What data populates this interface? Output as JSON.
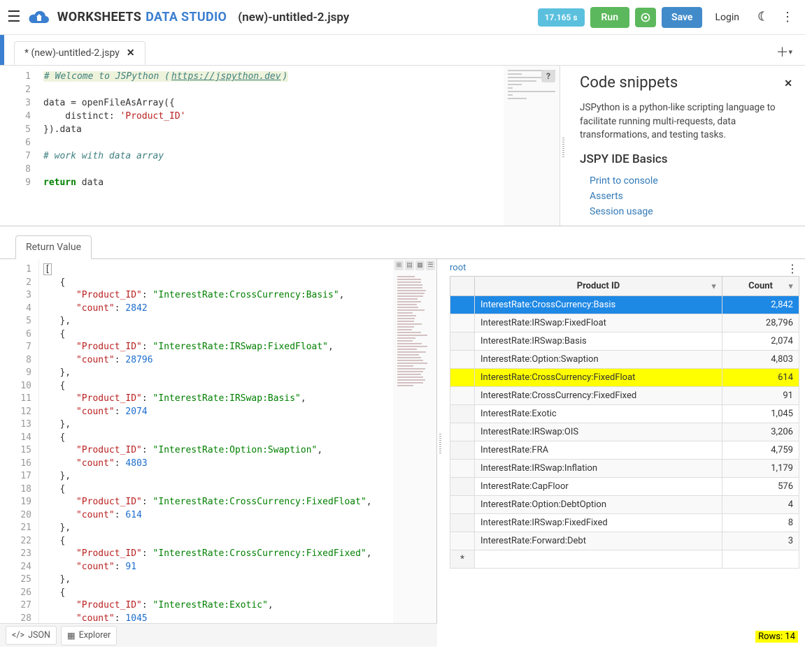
{
  "header": {
    "title_left": "WORKSHEETS",
    "title_right": "DATA STUDIO",
    "filename": "(new)-untitled-2.jspy",
    "time_badge": "17.165 s",
    "run": "Run",
    "save": "Save",
    "login": "Login"
  },
  "tabs": {
    "active": "* (new)-untitled-2.jspy"
  },
  "snippets": {
    "title": "Code snippets",
    "intro": "JSPython is a python-like scripting language to facilitate running multi-requests, data transformations, and testing tasks.",
    "basics_heading": "JSPY IDE Basics",
    "link_print": "Print to console",
    "link_asserts": "Asserts",
    "link_session": "Session usage"
  },
  "editor": {
    "lines": [
      {
        "n": "1",
        "toks": [
          {
            "cls": "cm-comment cm-highlight",
            "t": "# Welcome to JSPython ("
          },
          {
            "cls": "cm-comment cm-link cm-highlight",
            "t": "https://jspython.dev"
          },
          {
            "cls": "cm-comment cm-highlight",
            "t": ")"
          }
        ]
      },
      {
        "n": "2",
        "toks": []
      },
      {
        "n": "3",
        "toks": [
          {
            "cls": "",
            "t": "data = openFileAsArray({"
          }
        ]
      },
      {
        "n": "4",
        "toks": [
          {
            "cls": "",
            "t": "    distinct: "
          },
          {
            "cls": "cm-str",
            "t": "'Product_ID'"
          }
        ]
      },
      {
        "n": "5",
        "toks": [
          {
            "cls": "",
            "t": "}).data"
          }
        ]
      },
      {
        "n": "6",
        "toks": []
      },
      {
        "n": "7",
        "toks": [
          {
            "cls": "cm-comment",
            "t": "# work with data array"
          }
        ]
      },
      {
        "n": "8",
        "toks": []
      },
      {
        "n": "9",
        "toks": [
          {
            "cls": "cm-kw",
            "t": "return"
          },
          {
            "cls": "",
            "t": " data"
          }
        ]
      }
    ]
  },
  "result": {
    "tab": "Return Value",
    "json_btn": "JSON",
    "explorer_btn": "Explorer",
    "json_lines": 28,
    "items": [
      {
        "Product_ID": "InterestRate:CrossCurrency:Basis",
        "count": 2842
      },
      {
        "Product_ID": "InterestRate:IRSwap:FixedFloat",
        "count": 28796
      },
      {
        "Product_ID": "InterestRate:IRSwap:Basis",
        "count": 2074
      },
      {
        "Product_ID": "InterestRate:Option:Swaption",
        "count": 4803
      },
      {
        "Product_ID": "InterestRate:CrossCurrency:FixedFloat",
        "count": 614
      },
      {
        "Product_ID": "InterestRate:CrossCurrency:FixedFixed",
        "count": 91
      },
      {
        "Product_ID": "InterestRate:Exotic",
        "count": 1045
      }
    ]
  },
  "grid": {
    "crumb": "root",
    "col_product": "Product ID",
    "col_count": "Count",
    "rows": [
      {
        "p": "InterestRate:CrossCurrency:Basis",
        "c": "2,842",
        "sel": true
      },
      {
        "p": "InterestRate:IRSwap:FixedFloat",
        "c": "28,796"
      },
      {
        "p": "InterestRate:IRSwap:Basis",
        "c": "2,074"
      },
      {
        "p": "InterestRate:Option:Swaption",
        "c": "4,803"
      },
      {
        "p": "InterestRate:CrossCurrency:FixedFloat",
        "c": "614",
        "hl": true
      },
      {
        "p": "InterestRate:CrossCurrency:FixedFixed",
        "c": "91"
      },
      {
        "p": "InterestRate:Exotic",
        "c": "1,045"
      },
      {
        "p": "InterestRate:IRSwap:OIS",
        "c": "3,206"
      },
      {
        "p": "InterestRate:FRA",
        "c": "4,759"
      },
      {
        "p": "InterestRate:IRSwap:Inflation",
        "c": "1,179"
      },
      {
        "p": "InterestRate:CapFloor",
        "c": "576"
      },
      {
        "p": "InterestRate:Option:DebtOption",
        "c": "4"
      },
      {
        "p": "InterestRate:IRSwap:FixedFixed",
        "c": "8"
      },
      {
        "p": "InterestRate:Forward:Debt",
        "c": "3"
      }
    ],
    "rows_label": "Rows: 14"
  }
}
